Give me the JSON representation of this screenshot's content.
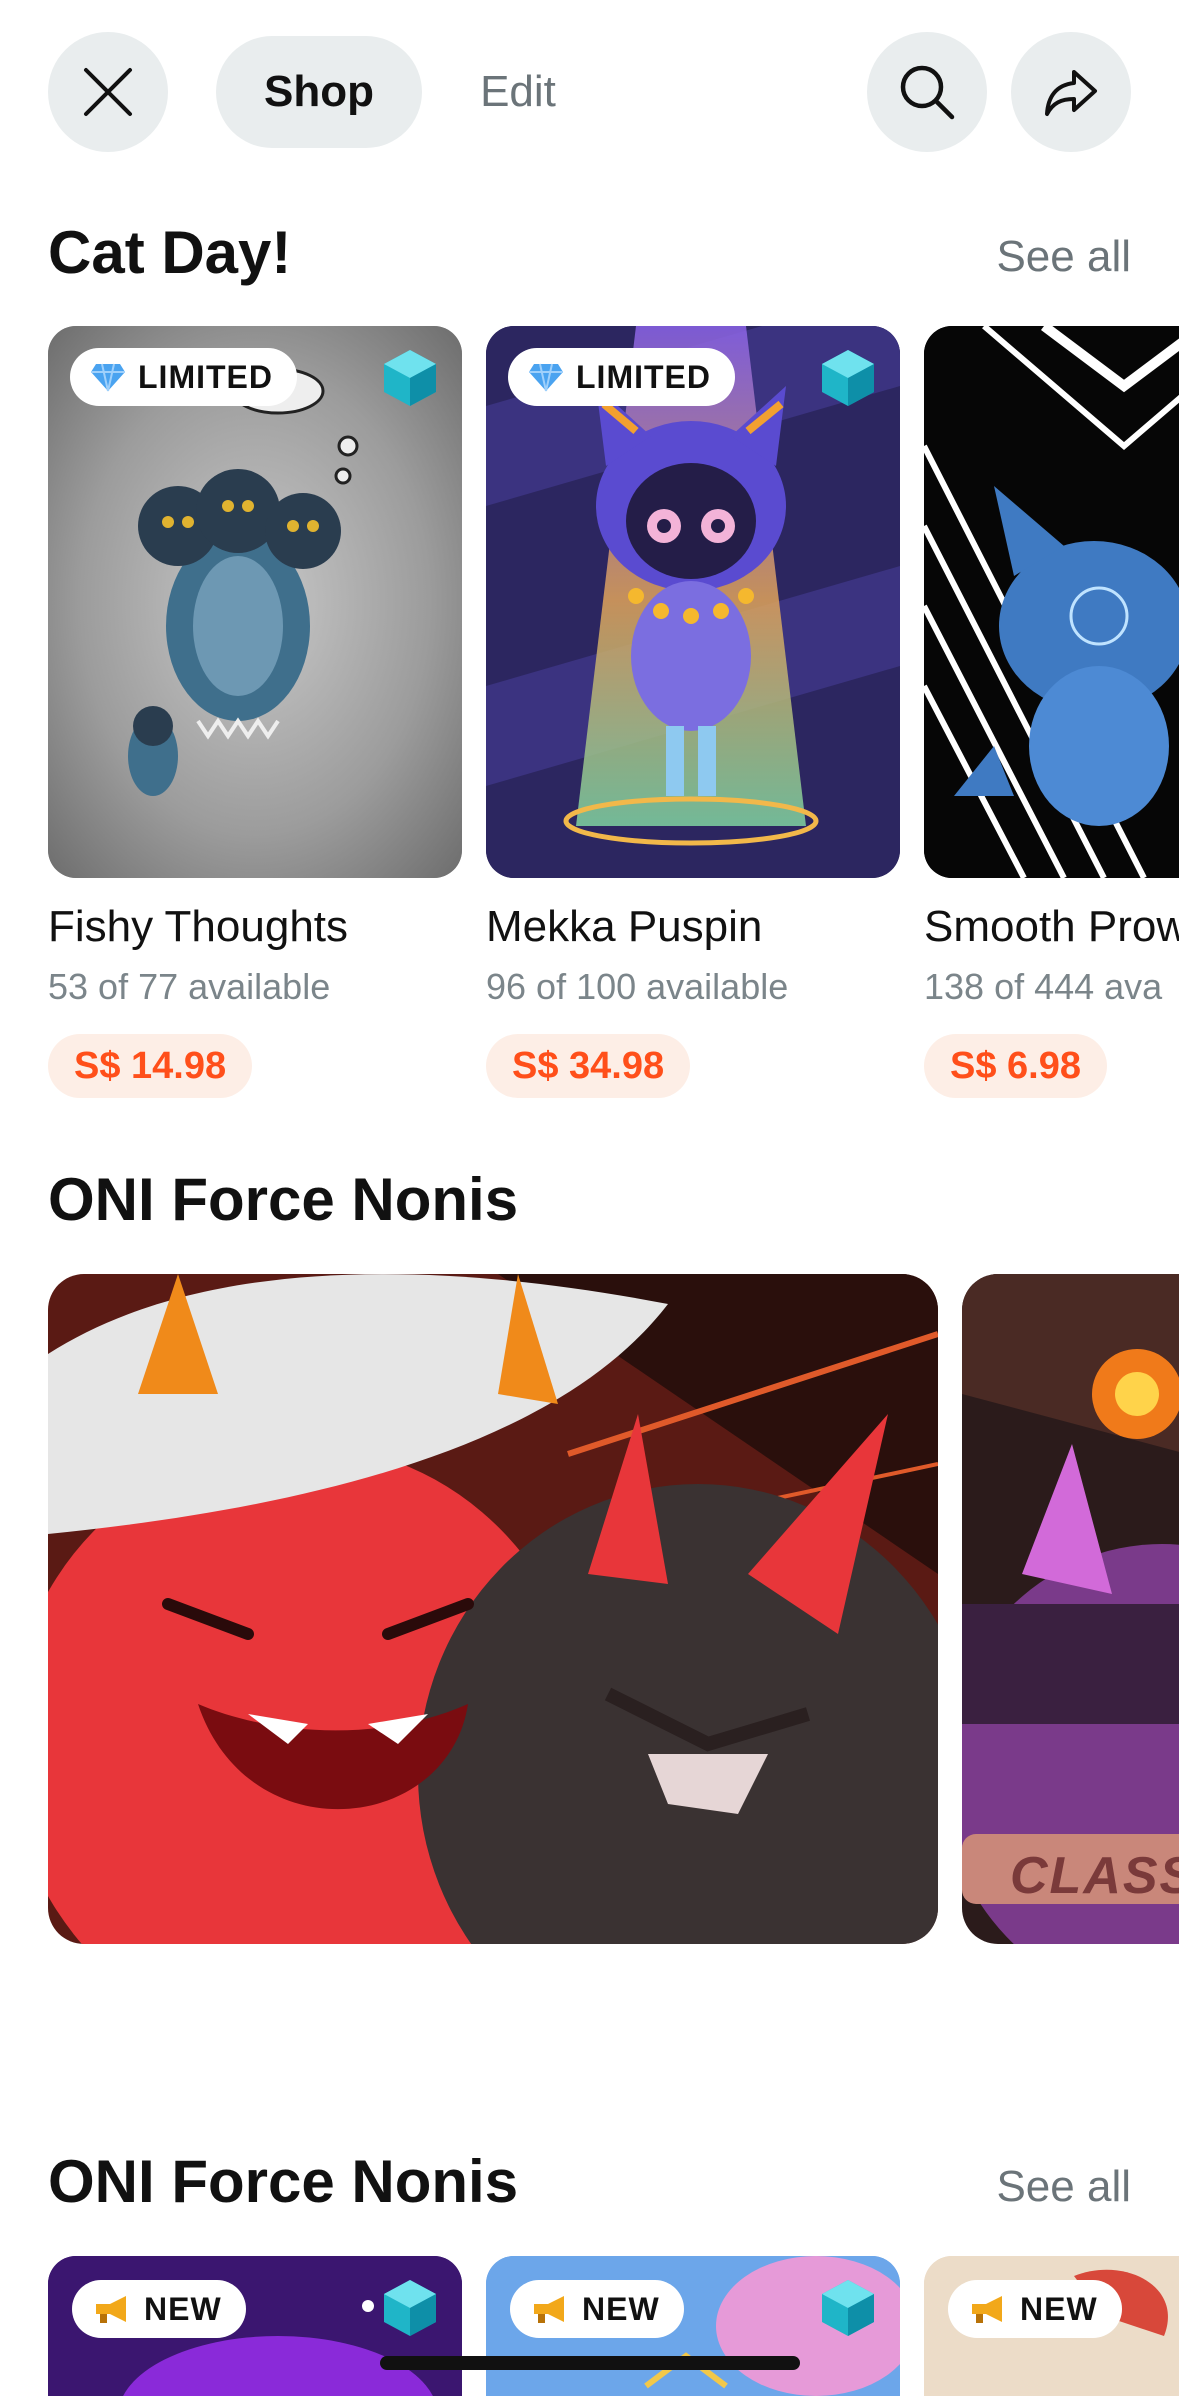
{
  "topbar": {
    "shop_label": "Shop",
    "edit_label": "Edit"
  },
  "sections": [
    {
      "title": "Cat Day!",
      "see_all": "See all",
      "items": [
        {
          "badge": "LIMITED",
          "name": "Fishy Thoughts",
          "availability": "53 of 77 available",
          "price": "S$ 14.98"
        },
        {
          "badge": "LIMITED",
          "name": "Mekka Puspin",
          "availability": "96 of 100 available",
          "price": "S$ 34.98"
        },
        {
          "badge": "",
          "name": "Smooth Prow",
          "availability": "138 of 444 ava",
          "price": "S$ 6.98"
        }
      ]
    },
    {
      "title": "ONI Force Nonis",
      "banner_text": "CLASS"
    },
    {
      "title": "ONI Force Nonis",
      "see_all": "See all",
      "items": [
        {
          "badge": "NEW"
        },
        {
          "badge": "NEW"
        },
        {
          "badge": "NEW"
        }
      ]
    }
  ],
  "colors": {
    "accent_price": "#ff4f1a",
    "price_bg": "#fdeee6",
    "button_bg": "#e9edee",
    "muted_text": "#6b7479"
  },
  "icons": [
    "close-icon",
    "search-icon",
    "share-icon",
    "diamond-icon",
    "cube-icon",
    "megaphone-icon"
  ]
}
